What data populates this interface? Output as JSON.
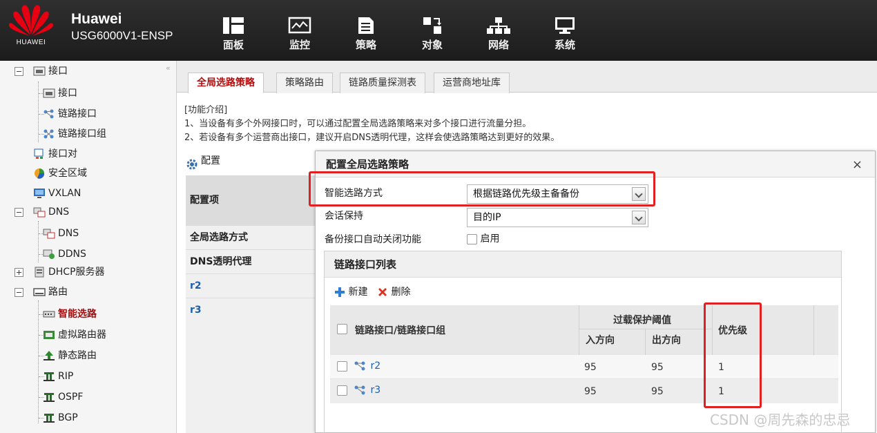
{
  "header": {
    "logo_word": "HUAWEI",
    "brand": "Huawei",
    "model": "USG6000V1-ENSP",
    "nav": [
      {
        "label": "面板",
        "icon": "dashboard-icon"
      },
      {
        "label": "监控",
        "icon": "monitor-icon"
      },
      {
        "label": "策略",
        "icon": "policy-icon"
      },
      {
        "label": "对象",
        "icon": "object-icon"
      },
      {
        "label": "网络",
        "icon": "network-icon"
      },
      {
        "label": "系统",
        "icon": "system-icon"
      }
    ]
  },
  "sidebar": {
    "collapse_glyph": "«",
    "items": [
      {
        "label": "接口",
        "icon": "interface-icon"
      },
      {
        "label": "接口",
        "icon": "interface-icon"
      },
      {
        "label": "链路接口",
        "icon": "link-interface-icon"
      },
      {
        "label": "链路接口组",
        "icon": "link-interface-group-icon"
      },
      {
        "label": "接口对",
        "icon": "interface-pair-icon"
      },
      {
        "label": "安全区域",
        "icon": "security-zone-icon"
      },
      {
        "label": "VXLAN",
        "icon": "vxlan-icon"
      },
      {
        "label": "DNS",
        "icon": "dns-icon"
      },
      {
        "label": "DNS",
        "icon": "dns-icon"
      },
      {
        "label": "DDNS",
        "icon": "ddns-icon"
      },
      {
        "label": "DHCP服务器",
        "icon": "dhcp-icon"
      },
      {
        "label": "路由",
        "icon": "route-icon"
      },
      {
        "label": "智能选路",
        "icon": "smart-route-icon"
      },
      {
        "label": "虚拟路由器",
        "icon": "virtual-router-icon"
      },
      {
        "label": "静态路由",
        "icon": "static-route-icon"
      },
      {
        "label": "RIP",
        "icon": "rip-icon"
      },
      {
        "label": "OSPF",
        "icon": "ospf-icon"
      },
      {
        "label": "BGP",
        "icon": "bgp-icon"
      }
    ]
  },
  "tabs": [
    "全局选路策略",
    "策略路由",
    "链路质量探测表",
    "运营商地址库"
  ],
  "intro": {
    "title": "[功能介绍]",
    "line1": "1、当设备有多个外网接口时，可以通过配置全局选路策略来对多个接口进行流量分担。",
    "line2": "2、若设备有多个运营商出接口，建议开启DNS透明代理，这样会使选路策略达到更好的效果。"
  },
  "config": {
    "header": "配置",
    "column_header": "配置项",
    "rows": [
      "全局选路方式",
      "DNS透明代理",
      "r2",
      "r3"
    ]
  },
  "dialog": {
    "title": "配置全局选路策略",
    "close": "×",
    "fields": {
      "mode_label": "智能选路方式",
      "mode_value": "根据链路优先级主备备份",
      "session_label": "会话保持",
      "session_value": "目的IP",
      "backup_label": "备份接口自动关闭功能",
      "backup_value": "启用"
    },
    "link_panel": {
      "title": "链路接口列表",
      "new_button": "新建",
      "delete_button": "删除",
      "columns": {
        "iface": "链路接口/链路接口组",
        "overload": "过载保护阈值",
        "in": "入方向",
        "out": "出方向",
        "priority": "优先级"
      },
      "rows": [
        {
          "iface": "r2",
          "in": "95",
          "out": "95",
          "priority": "1"
        },
        {
          "iface": "r3",
          "in": "95",
          "out": "95",
          "priority": "1"
        }
      ]
    }
  },
  "watermark": "CSDN @周先森的忠忌",
  "colors": {
    "highlight": "#e02020",
    "active": "#b01010",
    "link": "#1a5fb4"
  }
}
